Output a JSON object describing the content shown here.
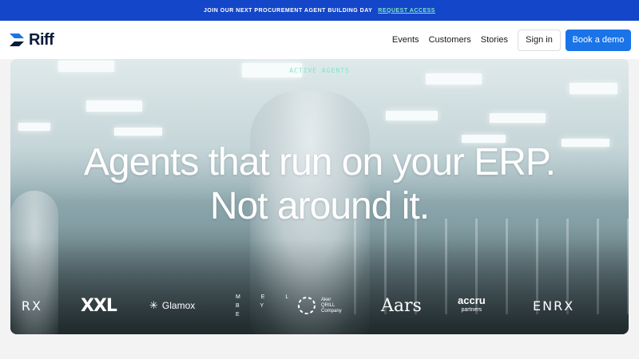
{
  "announcement": {
    "text": "JOIN OUR NEXT PROCUREMENT AGENT BUILDING DAY",
    "link": "REQUEST ACCESS"
  },
  "nav": {
    "logo": "Riff",
    "links": [
      "Events",
      "Customers",
      "Stories"
    ],
    "signin": "Sign in",
    "demo": "Book a demo"
  },
  "hero": {
    "eyebrow": "ACTIVE AGENTS",
    "headline_line1": "Agents that run on your ERP.",
    "headline_line2": "Not around it."
  },
  "logos": {
    "enrx_partial": "RX",
    "xxl": "XXL",
    "glamox": "Glamox",
    "melbye": [
      "M E L",
      "B Y",
      "E"
    ],
    "aker": [
      "Aker",
      "QRILL",
      "Company"
    ],
    "aars": "Aars",
    "accru": "accru",
    "accru_sub": "partners",
    "enrx": "ENRX"
  },
  "colors": {
    "announce_bg": "#1446c9",
    "accent_green": "#7ee7c4",
    "demo_button": "#1a74e8",
    "logo_navy": "#0b1b3a"
  }
}
